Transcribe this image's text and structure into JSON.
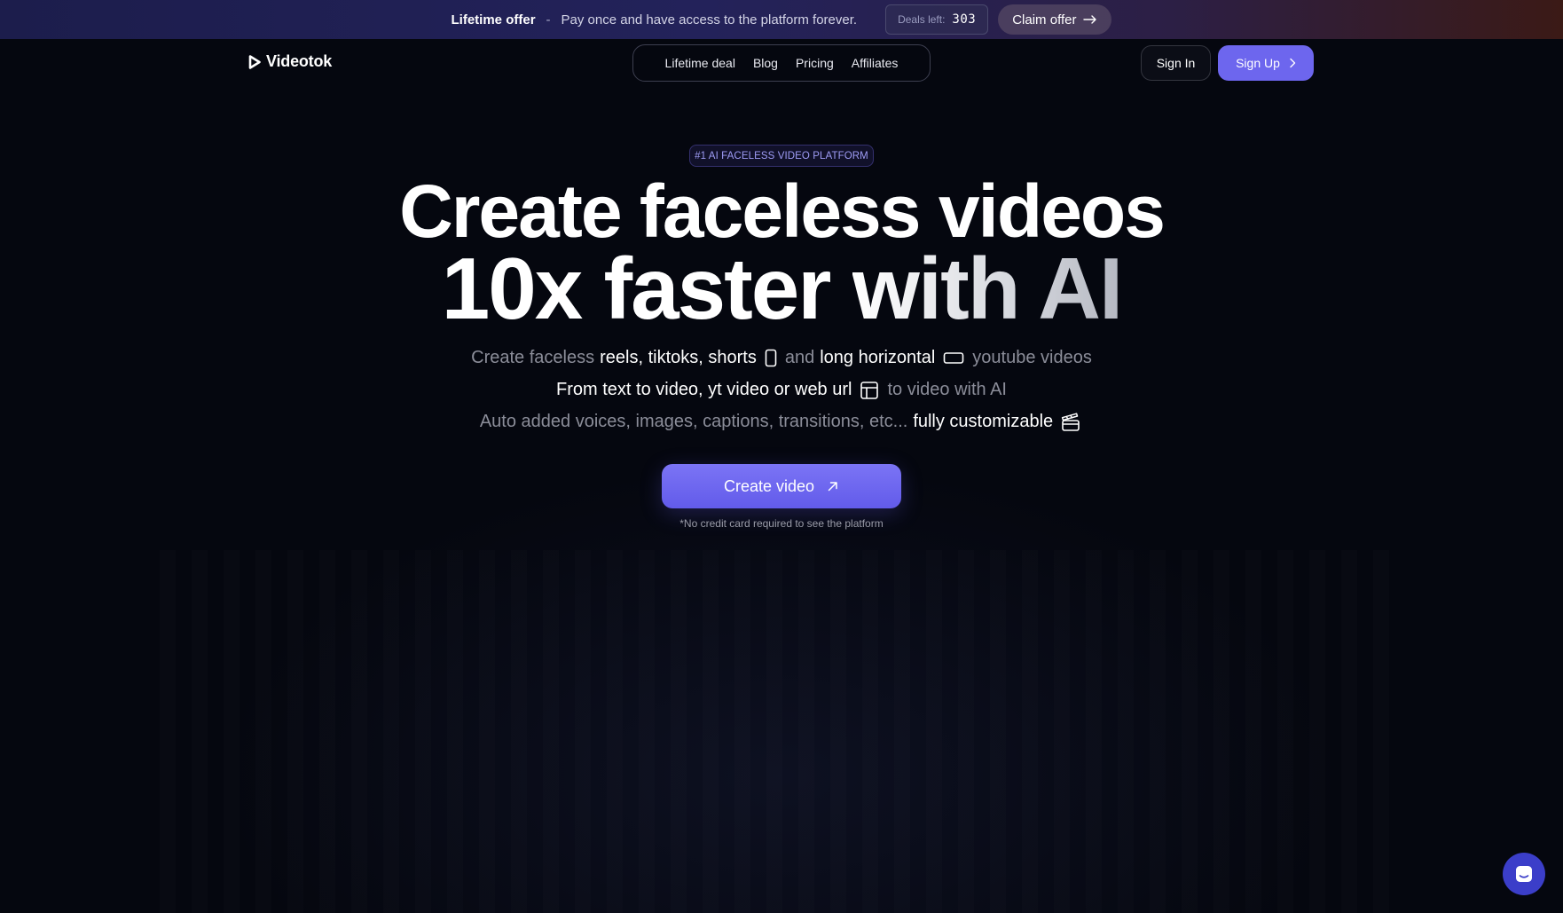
{
  "banner": {
    "title": "Lifetime offer",
    "separator": "-",
    "description": "Pay once and have access to the platform forever.",
    "deals_label": "Deals left:",
    "deals_count": "303",
    "claim_label": "Claim offer",
    "gradient_colors": [
      "#1c1d4c",
      "#23225a",
      "#2c1f45",
      "#3b1a16"
    ]
  },
  "header": {
    "logo_text": "Videotok",
    "nav": [
      "Lifetime deal",
      "Blog",
      "Pricing",
      "Affiliates"
    ],
    "sign_in": "Sign In",
    "sign_up": "Sign Up"
  },
  "hero": {
    "badge": "#1 AI FACELESS VIDEO PLATFORM",
    "headline_line1": "Create faceless videos",
    "headline_line2_a": "10x faster ",
    "headline_line2_b": "with AI",
    "line1": {
      "t1": "Create faceless",
      "t2": "reels, tiktoks, shorts",
      "t3": "and",
      "t4": "long horizontal",
      "t5": "youtube videos"
    },
    "line2": {
      "t1": "From text to video, yt video or web url",
      "t2": "to video with AI"
    },
    "line3": {
      "t1": "Auto added voices, images, captions, transitions, etc...",
      "t2": "fully customizable"
    },
    "cta_label": "Create video",
    "cta_note": "*No credit card required to see the platform"
  },
  "icons": {
    "logo": "play-icon",
    "claim": "arrow-right-icon",
    "sign_up": "chevron-right-icon",
    "vertical": "phone-portrait-icon",
    "horizontal": "screen-landscape-icon",
    "layout": "layout-template-icon",
    "customize": "clapperboard-icon",
    "cta": "arrow-up-right-icon",
    "chat": "chat-widget-icon"
  },
  "colors": {
    "background": "#05070f",
    "accent": "#6d66ee",
    "badge_text": "#9e9cf5",
    "chat_bubble": "#3b3ec9"
  }
}
